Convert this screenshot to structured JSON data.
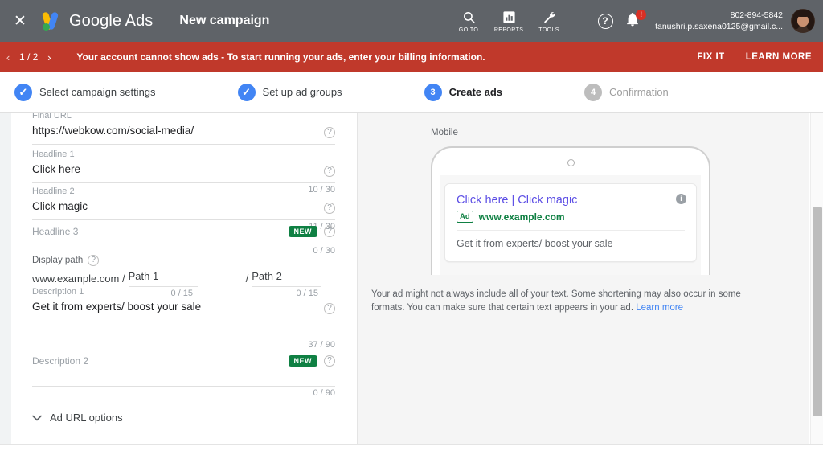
{
  "header": {
    "close_label": "✕",
    "brand": "Google Ads",
    "page_title": "New campaign",
    "nav": [
      {
        "icon": "search-icon",
        "caption": "GO TO"
      },
      {
        "icon": "bar-chart-icon",
        "caption": "REPORTS"
      },
      {
        "icon": "wrench-icon",
        "caption": "TOOLS"
      }
    ],
    "help_label": "?",
    "notification_badge": "!",
    "account_phone": "802-894-5842",
    "account_email": "tanushri.p.saxena0125@gmail.c...",
    "colors": {
      "header_bg": "#5f6368",
      "alert_bg": "#c0392b",
      "accent": "#4285f4"
    }
  },
  "alert": {
    "prev_arrow": "‹",
    "counter": "1 / 2",
    "next_arrow": "›",
    "message": "Your account cannot show ads - To start running your ads, enter your billing information.",
    "fix_label": "FIX IT",
    "learn_label": "LEARN MORE"
  },
  "stepper": {
    "steps": [
      {
        "marker": "✓",
        "label": "Select campaign settings",
        "state": "done"
      },
      {
        "marker": "✓",
        "label": "Set up ad groups",
        "state": "done"
      },
      {
        "marker": "3",
        "label": "Create ads",
        "state": "active"
      },
      {
        "marker": "4",
        "label": "Confirmation",
        "state": "todo"
      }
    ]
  },
  "form": {
    "final_url": {
      "label": "Final URL",
      "value": "https://webkow.com/social-media/",
      "counter": ""
    },
    "headline1": {
      "label": "Headline 1",
      "value": "Click here",
      "counter": "10 / 30"
    },
    "headline2": {
      "label": "Headline 2",
      "value": "Click magic",
      "counter": "11 / 30"
    },
    "headline3": {
      "label": "Headline 3",
      "value": "",
      "counter": "0 / 30",
      "badge": "NEW"
    },
    "display_path": {
      "label": "Display path",
      "domain": "www.example.com /",
      "path1_value": "Path 1",
      "path1_counter": "0 / 15",
      "path2_prefix": "/",
      "path2_value": "Path 2",
      "path2_counter": "0 / 15"
    },
    "description1": {
      "label": "Description 1",
      "value": "Get it from experts/  boost your sale",
      "counter": "37 / 90"
    },
    "description2": {
      "label": "Description 2",
      "value": "",
      "counter": "0 / 90",
      "badge": "NEW"
    },
    "url_options": {
      "label": "Ad URL options",
      "chevron": "⌄"
    },
    "help_glyph": "?"
  },
  "preview": {
    "device_label": "Mobile",
    "ad": {
      "headline": "Click here | Click magic",
      "ad_tag": "Ad",
      "url": "www.example.com",
      "description": "Get it from experts/ boost your sale",
      "info_glyph": "i"
    },
    "note_text": "Your ad might not always include all of your text. Some shortening may also occur in some formats. You can make sure that certain text appears in your ad. ",
    "note_link": "Learn more"
  }
}
